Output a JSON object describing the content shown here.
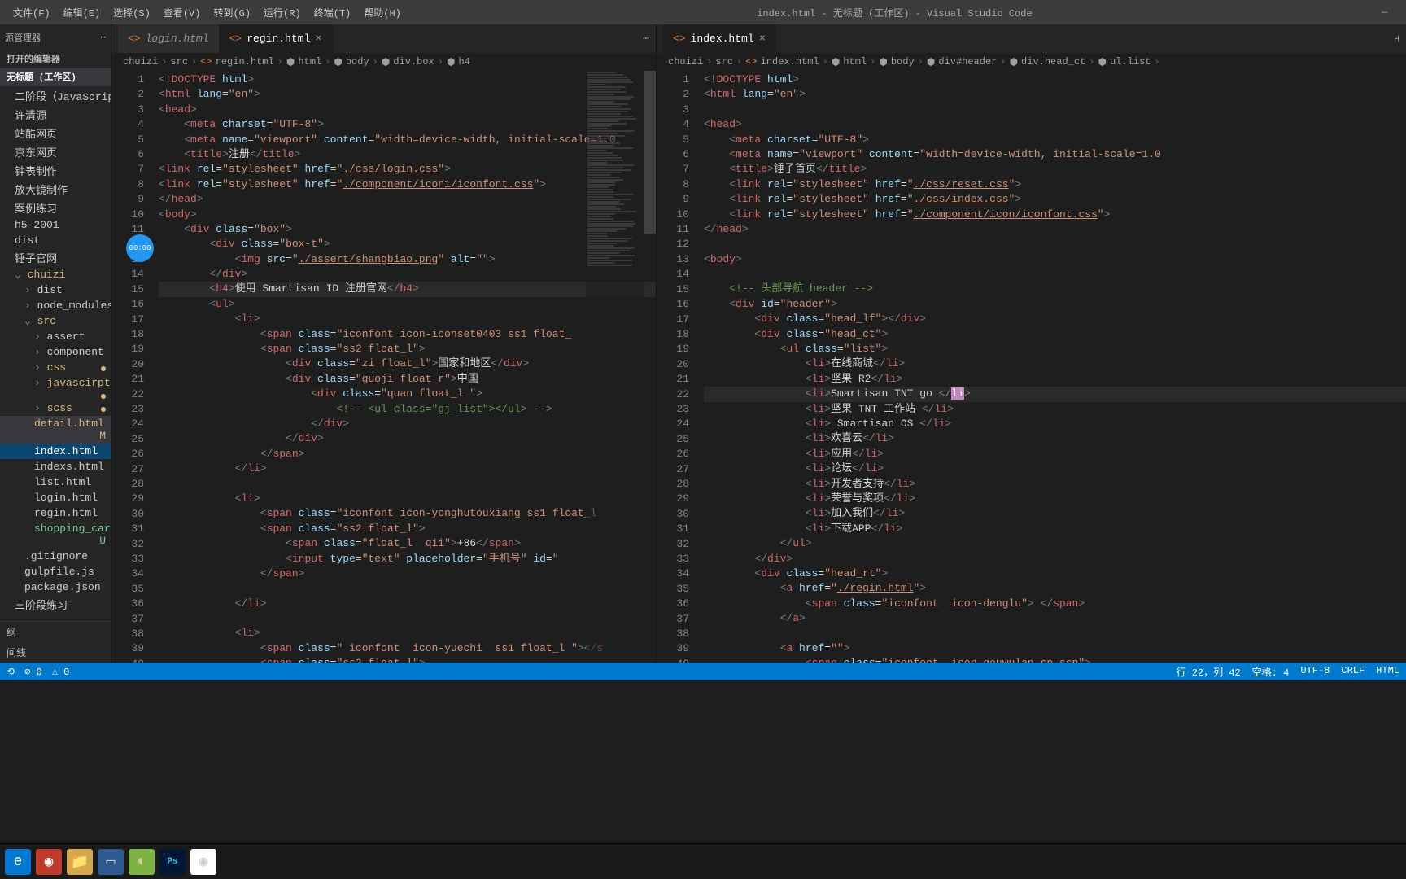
{
  "titlebar": {
    "menus": [
      "文件(F)",
      "编辑(E)",
      "选择(S)",
      "查看(V)",
      "转到(G)",
      "运行(R)",
      "终端(T)",
      "帮助(H)"
    ],
    "title": "index.html - 无标题 (工作区) - Visual Studio Code"
  },
  "sidebar": {
    "header": "源管理器",
    "sections": {
      "openEditors": "打开的编辑器",
      "workspace": "无标题 (工作区)"
    },
    "items": [
      "二阶段（JavaScript）",
      "许清源",
      "站酷网页",
      "京东网页",
      "钟表制作",
      "放大镜制作",
      "案例练习",
      "h5-2001",
      "dist",
      "锤子官网"
    ],
    "tree": {
      "chuizi": "chuizi",
      "dist": "dist",
      "node_modules": "node_modules",
      "src": "src",
      "srcChildren": [
        "assert",
        "component",
        "css",
        "javascirpts",
        "scss"
      ],
      "files": {
        "detail": "detail.html",
        "detail_badge": "M",
        "index": "index.html",
        "indexs": "indexs.html",
        "list": "list.html",
        "login": "login.html",
        "regin": "regin.html",
        "shopping": "shopping_car....",
        "shopping_badge": "U",
        "gitignore": ".gitignore",
        "gulpfile": "gulpfile.js",
        "package": "package.json"
      }
    },
    "bottom1": "三阶段练习",
    "bottom2": "纲",
    "bottom3": "间线"
  },
  "cursor_indicator": "00:00",
  "editor1": {
    "tabs": {
      "login": "login.html",
      "regin": "regin.html"
    },
    "breadcrumb": [
      "chuizi",
      "src",
      "regin.html",
      "html",
      "body",
      "div.box",
      "h4"
    ],
    "lines": {
      "l1": "<!DOCTYPE html>",
      "l2_a": "<",
      "l2_b": "html",
      "l2_c": " lang",
      "l2_d": "=",
      "l2_e": "\"en\"",
      "l2_f": ">",
      "l3": "<head>",
      "l4_a": "    <",
      "l4_b": "meta",
      "l4_c": " charset",
      "l4_d": "=\"UTF-8\">",
      "l5_a": "    <",
      "l5_b": "meta",
      "l5_c": " name",
      "l5_d": "=\"viewport\"",
      "l5_e": " content",
      "l5_f": "=\"width=device-width, initial-scale=1.0",
      "l6_a": "    <",
      "l6_b": "title",
      "l6_c": ">注册</",
      "l6_d": "title",
      "l6_e": ">",
      "l7_a": "<",
      "l7_b": "link",
      "l7_c": " rel",
      "l7_d": "=\"stylesheet\"",
      "l7_e": " href",
      "l7_f": "=\"",
      "l7_g": "./css/login.css",
      "l7_h": "\">",
      "l8_a": "<",
      "l8_b": "link",
      "l8_c": " rel",
      "l8_d": "=\"stylesheet\"",
      "l8_e": " href",
      "l8_f": "=\"",
      "l8_g": "./component/icon1/iconfont.css",
      "l8_h": "\">",
      "l9": "</head>",
      "l10": "<body>",
      "l11_a": "    <",
      "l11_b": "div",
      "l11_c": " class",
      "l11_d": "=\"box\">",
      "l12_a": "        <",
      "l12_b": "div",
      "l12_c": " class",
      "l12_d": "=\"box-t\">",
      "l13_a": "            <",
      "l13_b": "img",
      "l13_c": " src",
      "l13_d": "=\"",
      "l13_e": "./assert/shangbiao.png",
      "l13_f": "\"",
      "l13_g": " alt",
      "l13_h": "=\"\">",
      "l14": "        </div>",
      "l15_a": "        <",
      "l15_b": "h4",
      "l15_c": ">使用 Smartisan ID 注册官网</",
      "l15_d": "h4",
      "l15_e": ">",
      "l16": "        <ul>",
      "l17": "            <li>",
      "l18_a": "                <",
      "l18_b": "span",
      "l18_c": " class",
      "l18_d": "=\"iconfont icon-iconset0403 ss1 float_",
      "l19_a": "                <",
      "l19_b": "span",
      "l19_c": " class",
      "l19_d": "=\"ss2 float_l\">",
      "l20_a": "                    <",
      "l20_b": "div",
      "l20_c": " class",
      "l20_d": "=\"zi float_l\">国家和地区</",
      "l20_e": "div",
      "l20_f": ">",
      "l21_a": "                    <",
      "l21_b": "div",
      "l21_c": " class",
      "l21_d": "=\"guoji float_r\">中国",
      "l22_a": "                        <",
      "l22_b": "div",
      "l22_c": " class",
      "l22_d": "=\"quan float_l \">",
      "l23_a": "                            ",
      "l23_b": "<!-- <ul class=\"gj_list\"></ul> -->",
      "l24": "                        </div>",
      "l25": "                    </div>",
      "l26": "                </span>",
      "l27": "            </li>",
      "l28": "",
      "l29": "            <li>",
      "l30_a": "                <",
      "l30_b": "span",
      "l30_c": " class",
      "l30_d": "=\"iconfont icon-yonghutouxiang ss1 float_l",
      "l31_a": "                <",
      "l31_b": "span",
      "l31_c": " class",
      "l31_d": "=\"ss2 float_l\">",
      "l32_a": "                    <",
      "l32_b": "span",
      "l32_c": " class",
      "l32_d": "=\"float_l  qii\">+86</",
      "l32_e": "span",
      "l32_f": ">",
      "l33_a": "                    <",
      "l33_b": "input",
      "l33_c": " type",
      "l33_d": "=\"text\"",
      "l33_e": " placeholder",
      "l33_f": "=\"手机号\"",
      "l33_g": " id",
      "l33_h": "=\"",
      "l34": "                </span>",
      "l35": "",
      "l36": "            </li>",
      "l37": "",
      "l38": "            <li>",
      "l39_a": "                <",
      "l39_b": "span",
      "l39_c": " class",
      "l39_d": "=\" iconfont  icon-yuechi  ss1 float_l \"></s",
      "l40_a": "                <",
      "l40_b": "span",
      "l40_c": " class",
      "l40_d": "=\"ss2 float_l\">"
    }
  },
  "editor2": {
    "tab": "index.html",
    "breadcrumb": [
      "chuizi",
      "src",
      "index.html",
      "html",
      "body",
      "div#header",
      "div.head_ct",
      "ul.list"
    ],
    "lines": {
      "l1": "<!DOCTYPE html>",
      "l2": "<html lang=\"en\">",
      "l3": "",
      "l4": "<head>",
      "l5_a": "    <",
      "l5_b": "meta",
      "l5_c": " charset=\"UTF-8\">",
      "l6_a": "    <",
      "l6_b": "meta",
      "l6_c": " name=\"viewport\" content=\"width=device-width, initial-scale=1.0",
      "l7_a": "    <",
      "l7_b": "title",
      "l7_c": ">锤子首页</",
      "l7_d": "title",
      "l7_e": ">",
      "l8_a": "    <",
      "l8_b": "link",
      "l8_c": " rel=\"stylesheet\" href=\"",
      "l8_d": "./css/reset.css",
      "l8_e": "\">",
      "l9_a": "    <",
      "l9_b": "link",
      "l9_c": " rel=\"stylesheet\" href=\"",
      "l9_d": "./css/index.css",
      "l9_e": "\">",
      "l10_a": "    <",
      "l10_b": "link",
      "l10_c": " rel=\"stylesheet\" href=\"",
      "l10_d": "./component/icon/iconfont.css",
      "l10_e": "\">",
      "l11": "</head>",
      "l12": "",
      "l13": "<body>",
      "l14": "",
      "l15": "    <!-- 头部导航 header -->",
      "l16_a": "    <",
      "l16_b": "div",
      "l16_c": " id=\"header\">",
      "l17_a": "        <",
      "l17_b": "div",
      "l17_c": " class=\"head_lf\"></",
      "l17_d": "div",
      "l17_e": ">",
      "l18_a": "        <",
      "l18_b": "div",
      "l18_c": " class=\"head_ct\">",
      "l19_a": "            <",
      "l19_b": "ul",
      "l19_c": " class=\"list\">",
      "l20_a": "                <",
      "l20_b": "li",
      "l20_c": ">在线商城</",
      "l20_d": "li",
      "l20_e": ">",
      "l21_a": "                <",
      "l21_b": "li",
      "l21_c": ">坚果 R2</",
      "l21_d": "li",
      "l21_e": ">",
      "l22_a": "                <",
      "l22_b": "li",
      "l22_c": ">Smartisan TNT go </",
      "l22_d": "li",
      "l22_e": ">",
      "l23_a": "                <",
      "l23_b": "li",
      "l23_c": ">坚果 TNT 工作站 </",
      "l23_d": "li",
      "l23_e": ">",
      "l24_a": "                <",
      "l24_b": "li",
      "l24_c": "> Smartisan OS </",
      "l24_d": "li",
      "l24_e": ">",
      "l25_a": "                <",
      "l25_b": "li",
      "l25_c": ">欢喜云</",
      "l25_d": "li",
      "l25_e": ">",
      "l26_a": "                <",
      "l26_b": "li",
      "l26_c": ">应用</",
      "l26_d": "li",
      "l26_e": ">",
      "l27_a": "                <",
      "l27_b": "li",
      "l27_c": ">论坛</",
      "l27_d": "li",
      "l27_e": ">",
      "l28_a": "                <",
      "l28_b": "li",
      "l28_c": ">开发者支持</",
      "l28_d": "li",
      "l28_e": ">",
      "l29_a": "                <",
      "l29_b": "li",
      "l29_c": ">荣誉与奖项</",
      "l29_d": "li",
      "l29_e": ">",
      "l30_a": "                <",
      "l30_b": "li",
      "l30_c": ">加入我们</",
      "l30_d": "li",
      "l30_e": ">",
      "l31_a": "                <",
      "l31_b": "li",
      "l31_c": ">下载APP</",
      "l31_d": "li",
      "l31_e": ">",
      "l32": "            </ul>",
      "l33": "        </div>",
      "l34_a": "        <",
      "l34_b": "div",
      "l34_c": " class=\"head_rt\">",
      "l35_a": "            <",
      "l35_b": "a",
      "l35_c": " href=\"",
      "l35_d": "./regin.html",
      "l35_e": "\">",
      "l36_a": "                <",
      "l36_b": "span",
      "l36_c": " class=\"iconfont  icon-denglu\"> </",
      "l36_d": "span",
      "l36_e": ">",
      "l37": "            </a>",
      "l38": "",
      "l39_a": "            <",
      "l39_b": "a",
      "l39_c": " href=\"\">",
      "l40_a": "                <",
      "l40_b": "span",
      "l40_c": " class=\"iconfont  icon-gouwulan sp ssp\">"
    }
  },
  "statusbar": {
    "errors": "0",
    "warnings": "0",
    "line_col": "行 22，列 42",
    "spaces": "空格: 4",
    "encoding": "UTF-8",
    "eol": "CRLF",
    "lang": "HTML"
  }
}
